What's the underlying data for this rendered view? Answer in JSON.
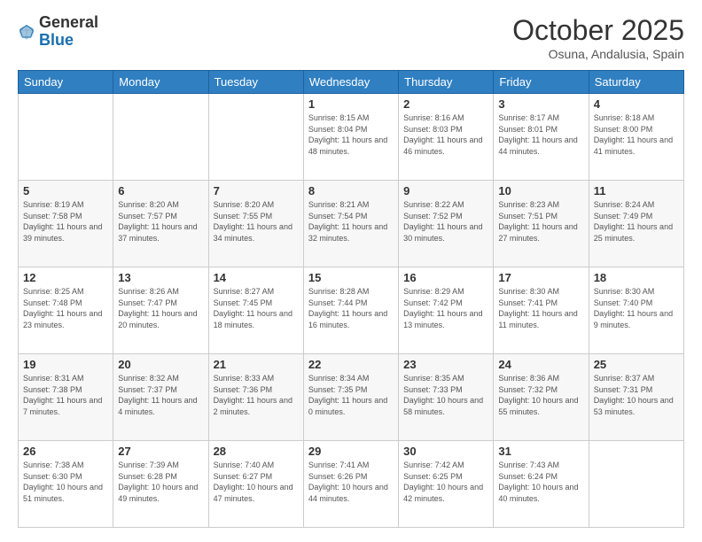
{
  "logo": {
    "general": "General",
    "blue": "Blue"
  },
  "title": "October 2025",
  "location": "Osuna, Andalusia, Spain",
  "days_of_week": [
    "Sunday",
    "Monday",
    "Tuesday",
    "Wednesday",
    "Thursday",
    "Friday",
    "Saturday"
  ],
  "weeks": [
    [
      {
        "day": "",
        "info": ""
      },
      {
        "day": "",
        "info": ""
      },
      {
        "day": "",
        "info": ""
      },
      {
        "day": "1",
        "info": "Sunrise: 8:15 AM\nSunset: 8:04 PM\nDaylight: 11 hours\nand 48 minutes."
      },
      {
        "day": "2",
        "info": "Sunrise: 8:16 AM\nSunset: 8:03 PM\nDaylight: 11 hours\nand 46 minutes."
      },
      {
        "day": "3",
        "info": "Sunrise: 8:17 AM\nSunset: 8:01 PM\nDaylight: 11 hours\nand 44 minutes."
      },
      {
        "day": "4",
        "info": "Sunrise: 8:18 AM\nSunset: 8:00 PM\nDaylight: 11 hours\nand 41 minutes."
      }
    ],
    [
      {
        "day": "5",
        "info": "Sunrise: 8:19 AM\nSunset: 7:58 PM\nDaylight: 11 hours\nand 39 minutes."
      },
      {
        "day": "6",
        "info": "Sunrise: 8:20 AM\nSunset: 7:57 PM\nDaylight: 11 hours\nand 37 minutes."
      },
      {
        "day": "7",
        "info": "Sunrise: 8:20 AM\nSunset: 7:55 PM\nDaylight: 11 hours\nand 34 minutes."
      },
      {
        "day": "8",
        "info": "Sunrise: 8:21 AM\nSunset: 7:54 PM\nDaylight: 11 hours\nand 32 minutes."
      },
      {
        "day": "9",
        "info": "Sunrise: 8:22 AM\nSunset: 7:52 PM\nDaylight: 11 hours\nand 30 minutes."
      },
      {
        "day": "10",
        "info": "Sunrise: 8:23 AM\nSunset: 7:51 PM\nDaylight: 11 hours\nand 27 minutes."
      },
      {
        "day": "11",
        "info": "Sunrise: 8:24 AM\nSunset: 7:49 PM\nDaylight: 11 hours\nand 25 minutes."
      }
    ],
    [
      {
        "day": "12",
        "info": "Sunrise: 8:25 AM\nSunset: 7:48 PM\nDaylight: 11 hours\nand 23 minutes."
      },
      {
        "day": "13",
        "info": "Sunrise: 8:26 AM\nSunset: 7:47 PM\nDaylight: 11 hours\nand 20 minutes."
      },
      {
        "day": "14",
        "info": "Sunrise: 8:27 AM\nSunset: 7:45 PM\nDaylight: 11 hours\nand 18 minutes."
      },
      {
        "day": "15",
        "info": "Sunrise: 8:28 AM\nSunset: 7:44 PM\nDaylight: 11 hours\nand 16 minutes."
      },
      {
        "day": "16",
        "info": "Sunrise: 8:29 AM\nSunset: 7:42 PM\nDaylight: 11 hours\nand 13 minutes."
      },
      {
        "day": "17",
        "info": "Sunrise: 8:30 AM\nSunset: 7:41 PM\nDaylight: 11 hours\nand 11 minutes."
      },
      {
        "day": "18",
        "info": "Sunrise: 8:30 AM\nSunset: 7:40 PM\nDaylight: 11 hours\nand 9 minutes."
      }
    ],
    [
      {
        "day": "19",
        "info": "Sunrise: 8:31 AM\nSunset: 7:38 PM\nDaylight: 11 hours\nand 7 minutes."
      },
      {
        "day": "20",
        "info": "Sunrise: 8:32 AM\nSunset: 7:37 PM\nDaylight: 11 hours\nand 4 minutes."
      },
      {
        "day": "21",
        "info": "Sunrise: 8:33 AM\nSunset: 7:36 PM\nDaylight: 11 hours\nand 2 minutes."
      },
      {
        "day": "22",
        "info": "Sunrise: 8:34 AM\nSunset: 7:35 PM\nDaylight: 11 hours\nand 0 minutes."
      },
      {
        "day": "23",
        "info": "Sunrise: 8:35 AM\nSunset: 7:33 PM\nDaylight: 10 hours\nand 58 minutes."
      },
      {
        "day": "24",
        "info": "Sunrise: 8:36 AM\nSunset: 7:32 PM\nDaylight: 10 hours\nand 55 minutes."
      },
      {
        "day": "25",
        "info": "Sunrise: 8:37 AM\nSunset: 7:31 PM\nDaylight: 10 hours\nand 53 minutes."
      }
    ],
    [
      {
        "day": "26",
        "info": "Sunrise: 7:38 AM\nSunset: 6:30 PM\nDaylight: 10 hours\nand 51 minutes."
      },
      {
        "day": "27",
        "info": "Sunrise: 7:39 AM\nSunset: 6:28 PM\nDaylight: 10 hours\nand 49 minutes."
      },
      {
        "day": "28",
        "info": "Sunrise: 7:40 AM\nSunset: 6:27 PM\nDaylight: 10 hours\nand 47 minutes."
      },
      {
        "day": "29",
        "info": "Sunrise: 7:41 AM\nSunset: 6:26 PM\nDaylight: 10 hours\nand 44 minutes."
      },
      {
        "day": "30",
        "info": "Sunrise: 7:42 AM\nSunset: 6:25 PM\nDaylight: 10 hours\nand 42 minutes."
      },
      {
        "day": "31",
        "info": "Sunrise: 7:43 AM\nSunset: 6:24 PM\nDaylight: 10 hours\nand 40 minutes."
      },
      {
        "day": "",
        "info": ""
      }
    ]
  ]
}
